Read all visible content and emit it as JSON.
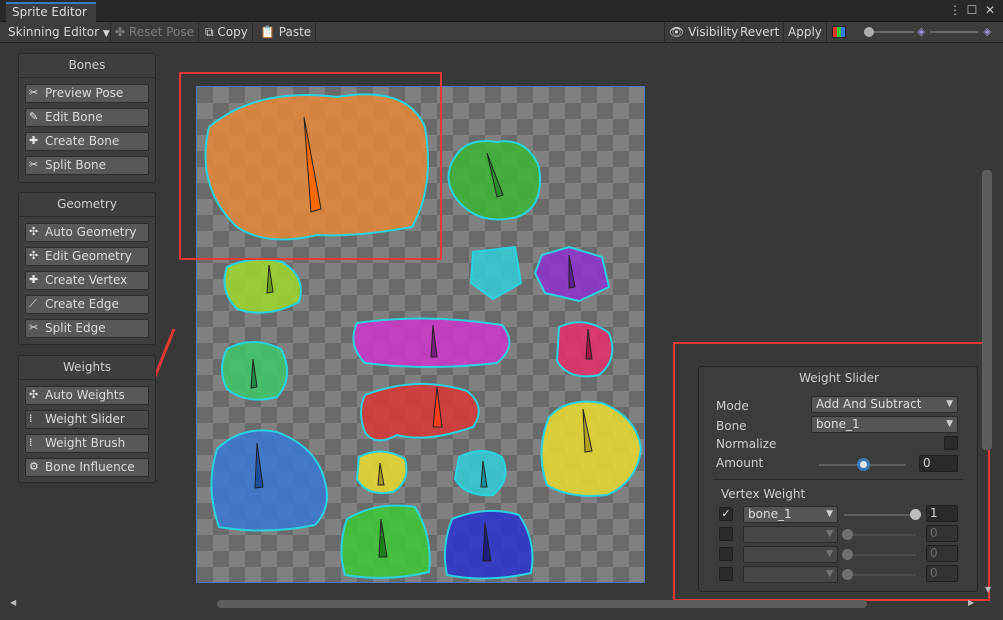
{
  "window": {
    "tab_title": "Sprite Editor"
  },
  "toolbar": {
    "mode_dropdown": "Skinning Editor",
    "reset_pose": "Reset Pose",
    "copy": "Copy",
    "paste": "Paste",
    "visibility": "Visibility",
    "revert": "Revert",
    "apply": "Apply"
  },
  "bones_panel": {
    "title": "Bones",
    "buttons": [
      "Preview Pose",
      "Edit Bone",
      "Create Bone",
      "Split Bone"
    ]
  },
  "geometry_panel": {
    "title": "Geometry",
    "buttons": [
      "Auto Geometry",
      "Edit Geometry",
      "Create Vertex",
      "Create Edge",
      "Split Edge"
    ]
  },
  "weights_panel": {
    "title": "Weights",
    "buttons": [
      "Auto Weights",
      "Weight Slider",
      "Weight Brush",
      "Bone Influence"
    ],
    "selected": "Weight Slider"
  },
  "weight_slider_panel": {
    "title": "Weight Slider",
    "mode_label": "Mode",
    "mode_value": "Add And Subtract",
    "bone_label": "Bone",
    "bone_value": "bone_1",
    "normalize_label": "Normalize",
    "amount_label": "Amount",
    "amount_value": "0",
    "vertex_weight_title": "Vertex Weight",
    "rows": [
      {
        "bone": "bone_1",
        "value": "1",
        "checked": true,
        "enabled": true
      },
      {
        "bone": "",
        "value": "0",
        "checked": false,
        "enabled": false
      },
      {
        "bone": "",
        "value": "0",
        "checked": false,
        "enabled": false
      },
      {
        "bone": "",
        "value": "0",
        "checked": false,
        "enabled": false
      }
    ]
  },
  "colors": {
    "accent_blue": "#3a79bb",
    "highlight_red": "#e53935",
    "mesh_outline": "#29d3e0"
  }
}
